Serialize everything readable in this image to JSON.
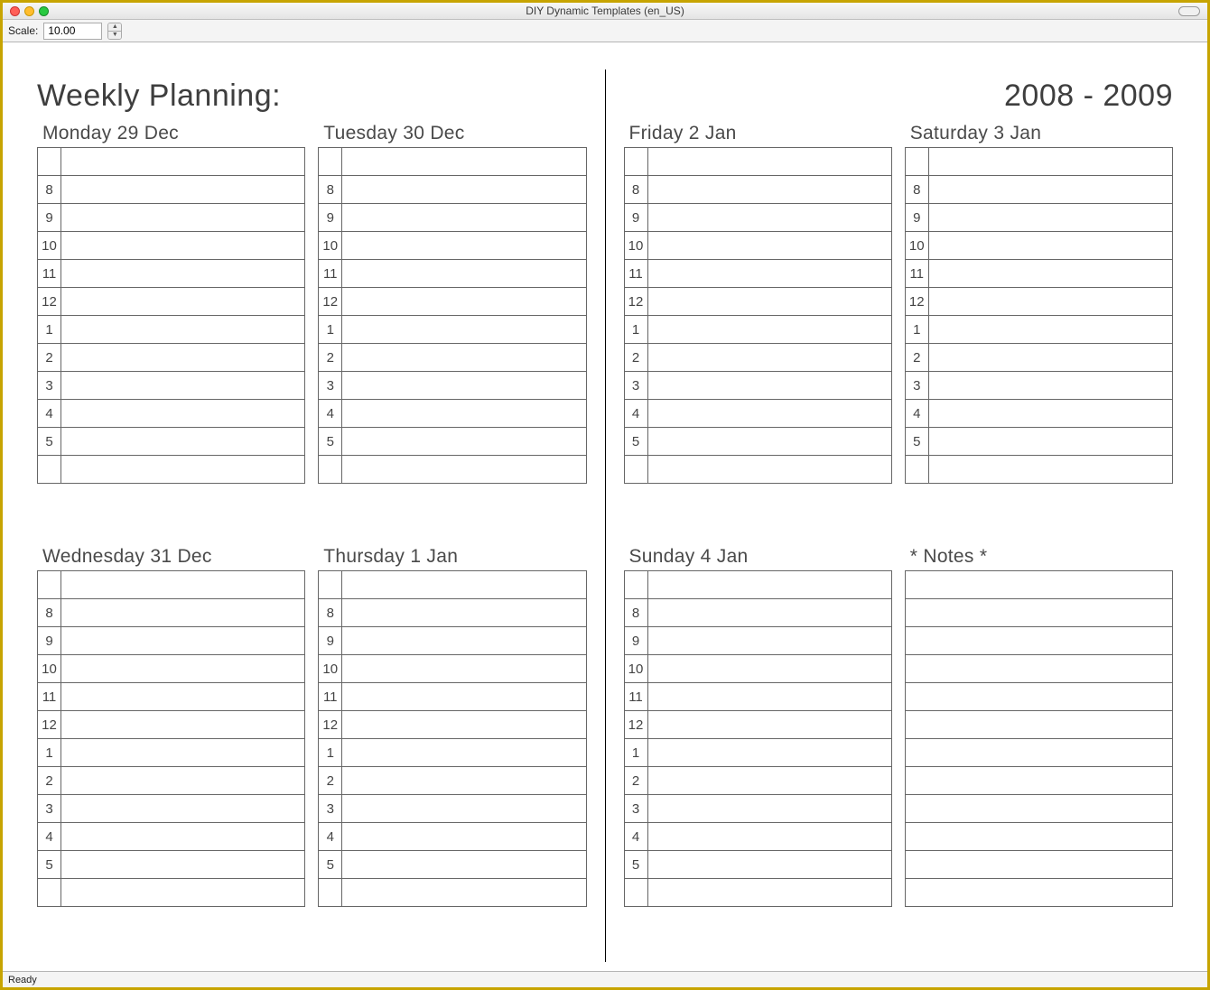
{
  "window": {
    "title": "DIY Dynamic Templates (en_US)"
  },
  "toolbar": {
    "scale_label": "Scale:",
    "scale_value": "10.00"
  },
  "status": {
    "text": "Ready"
  },
  "planner": {
    "left_title": "Weekly Planning:",
    "right_title": "2008 - 2009",
    "hours": [
      "",
      "8",
      "9",
      "10",
      "11",
      "12",
      "1",
      "2",
      "3",
      "4",
      "5",
      ""
    ],
    "notes_title": "* Notes *",
    "notes_rows": 12,
    "left_days": [
      {
        "title": "Monday 29 Dec"
      },
      {
        "title": "Tuesday 30 Dec"
      },
      {
        "title": "Wednesday 31 Dec"
      },
      {
        "title": "Thursday 1 Jan"
      }
    ],
    "right_days": [
      {
        "title": "Friday 2 Jan"
      },
      {
        "title": "Saturday 3 Jan"
      },
      {
        "title": "Sunday 4 Jan"
      }
    ]
  }
}
